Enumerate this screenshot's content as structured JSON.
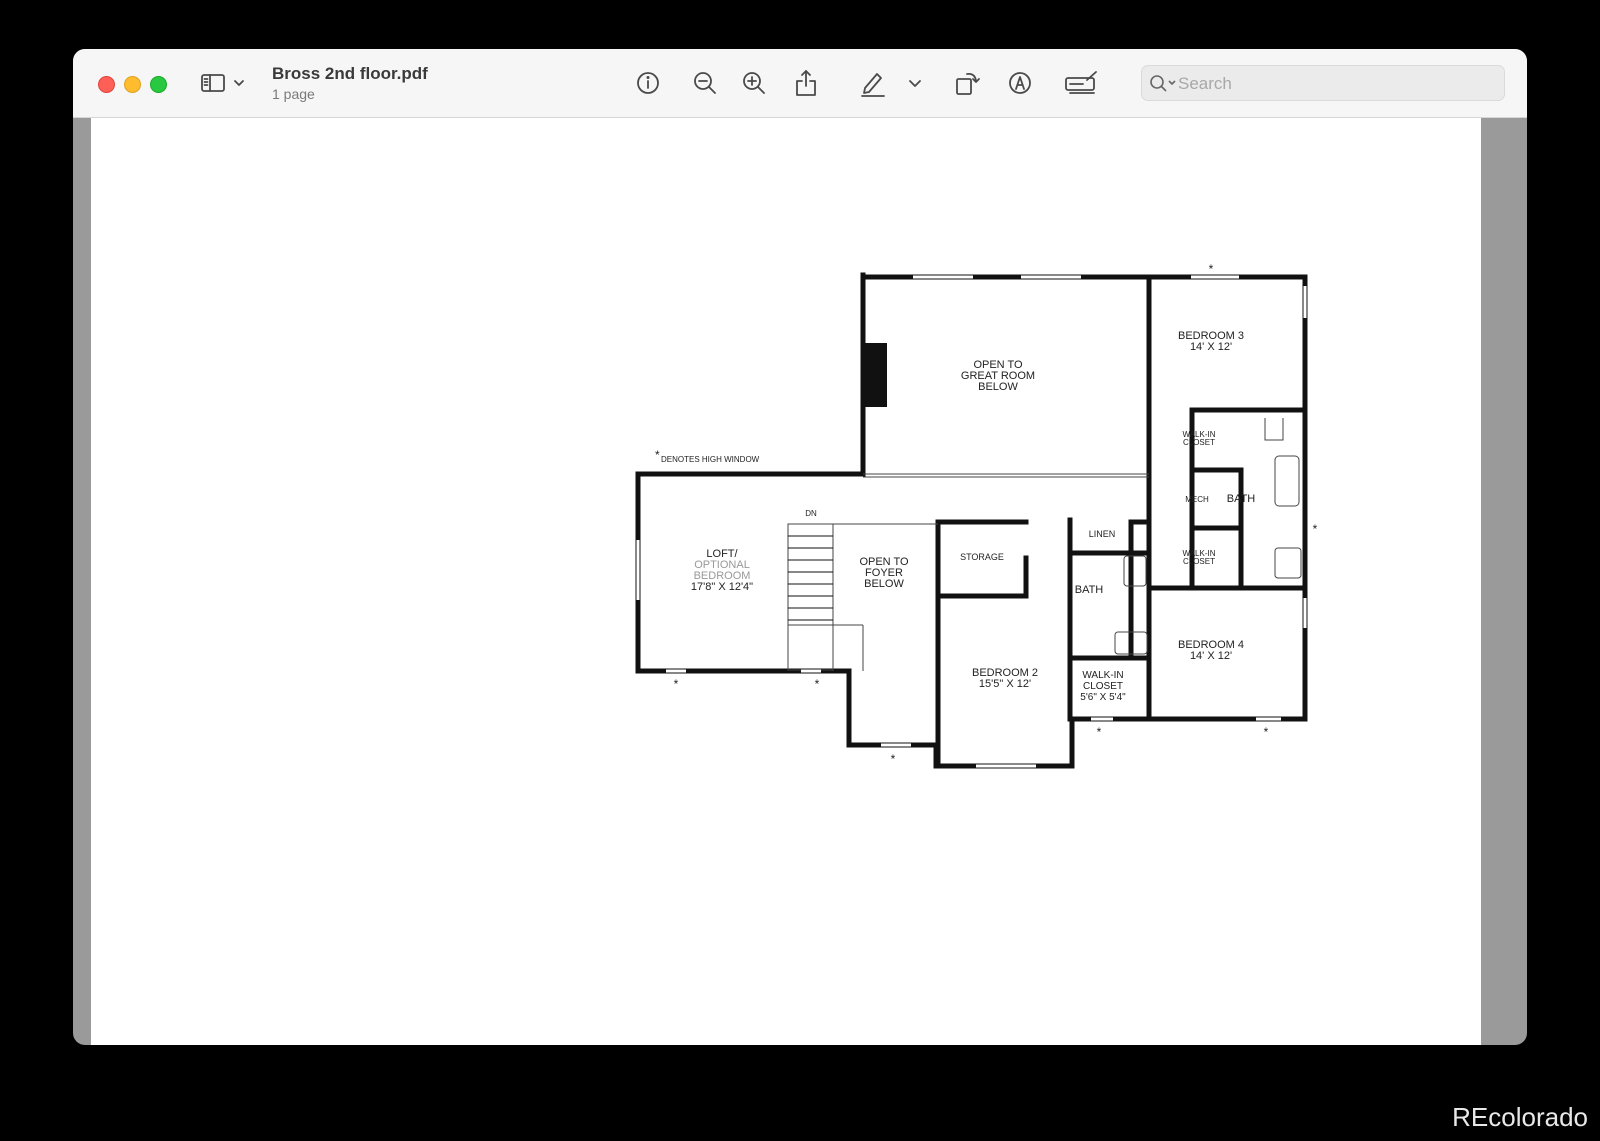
{
  "window": {
    "doc_title": "Bross 2nd floor.pdf",
    "doc_subtitle": "1 page",
    "search_placeholder": "Search",
    "toolbar_icons": [
      "sidebar-icon",
      "chevron-down-icon",
      "info-icon",
      "zoom-out-icon",
      "zoom-in-icon",
      "share-icon",
      "markup-pen-icon",
      "chevron-down-icon",
      "rotate-icon",
      "annotate-icon",
      "form-fill-icon",
      "search-icon"
    ]
  },
  "floorplan": {
    "legend_symbol": "*",
    "legend_text": "DENOTES HIGH WINDOW",
    "rooms": {
      "great_room": [
        "OPEN TO",
        "GREAT ROOM",
        "BELOW"
      ],
      "bedroom3": [
        "BEDROOM 3",
        "14' X 12'"
      ],
      "walkin_closet_top": [
        "WALK-IN",
        "CLOSET"
      ],
      "mech": "MECH",
      "bath_master": "BATH",
      "walkin_closet_bottom": [
        "WALK-IN",
        "CLOSET"
      ],
      "loft": [
        "LOFT/",
        "OPTIONAL",
        "BEDROOM",
        "17'8\" X 12'4\""
      ],
      "stairs_label": "DN",
      "foyer": [
        "OPEN TO",
        "FOYER",
        "BELOW"
      ],
      "storage": "STORAGE",
      "linen": "LINEN",
      "bath_hall": "BATH",
      "bedroom2": [
        "BEDROOM 2",
        "15'5\" X 12'"
      ],
      "walkin_closet_b2": [
        "WALK-IN",
        "CLOSET",
        "5'6\" X 5'4\""
      ],
      "bedroom4": [
        "BEDROOM 4",
        "14' X 12'"
      ]
    }
  },
  "watermark": "REcolorado",
  "colors": {
    "close": "#fe5f57",
    "minimize": "#febc2e",
    "maximize": "#28c840",
    "wall": "#111111",
    "gray_text": "#999999"
  }
}
